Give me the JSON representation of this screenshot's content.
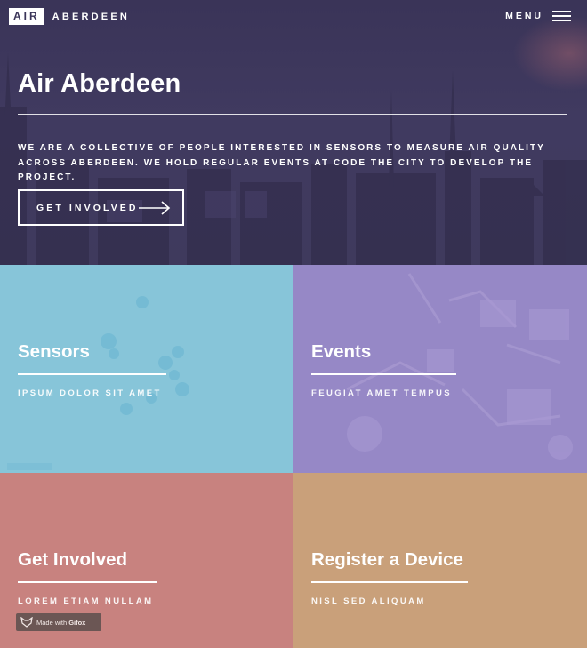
{
  "header": {
    "logo_box": "AIR",
    "logo_name": "ABERDEEN",
    "menu_label": "MENU"
  },
  "hero": {
    "title": "Air Aberdeen",
    "description": "We are a collective of people interested in sensors to measure air quality across Aberdeen. We hold regular events at Code The City to develop the project.",
    "cta_label": "GET INVOLVED"
  },
  "tiles": [
    {
      "title": "Sensors",
      "subtitle": "IPSUM DOLOR SIT AMET",
      "color": "#87c5d9"
    },
    {
      "title": "Events",
      "subtitle": "FEUGIAT AMET TEMPUS",
      "color": "#9688c6"
    },
    {
      "title": "Get Involved",
      "subtitle": "LOREM ETIAM NULLAM",
      "color": "#c8827f"
    },
    {
      "title": "Register a Device",
      "subtitle": "NISL SED ALIQUAM",
      "color": "#c9a07a"
    }
  ],
  "watermark": {
    "prefix": "Made with",
    "brand": "Gifox"
  },
  "icons": {
    "menu": "hamburger-menu-icon",
    "cta": "arrow-right-icon",
    "watermark": "fox-icon"
  }
}
